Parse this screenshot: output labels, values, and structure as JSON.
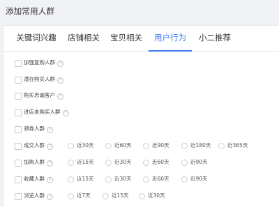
{
  "page": {
    "title": "添加常用人群"
  },
  "tabs": [
    {
      "label": "关键词兴趣"
    },
    {
      "label": "店铺相关"
    },
    {
      "label": "宝贝相关"
    },
    {
      "label": "用户行为",
      "active": true
    },
    {
      "label": "小二推荐"
    }
  ],
  "rows": [
    {
      "label": "加强复购人群",
      "help": true
    },
    {
      "label": "潜在购买人群",
      "help": true
    },
    {
      "label": "购买忠诚客户",
      "help": true
    },
    {
      "label": "进店未购买人群",
      "help": true
    },
    {
      "label": "领券人群",
      "help": true
    },
    {
      "label": "成交人群",
      "help": true,
      "options": [
        "近30天",
        "近60天",
        "近90天",
        "近180天",
        "近365天"
      ]
    },
    {
      "label": "加购人群",
      "help": true,
      "options": [
        "近15天",
        "近30天",
        "近60天",
        "近90天"
      ]
    },
    {
      "label": "收藏人群",
      "help": true,
      "options": [
        "近15天",
        "近30天",
        "近60天",
        "近90天"
      ]
    },
    {
      "label": "浏览人群",
      "help": true,
      "options": [
        "近7天",
        "近15天",
        "近30天"
      ]
    }
  ],
  "help_glyph": "?",
  "colors": {
    "accent": "#3d7df5",
    "background": "#f0f2f5",
    "panel": "#ffffff"
  }
}
